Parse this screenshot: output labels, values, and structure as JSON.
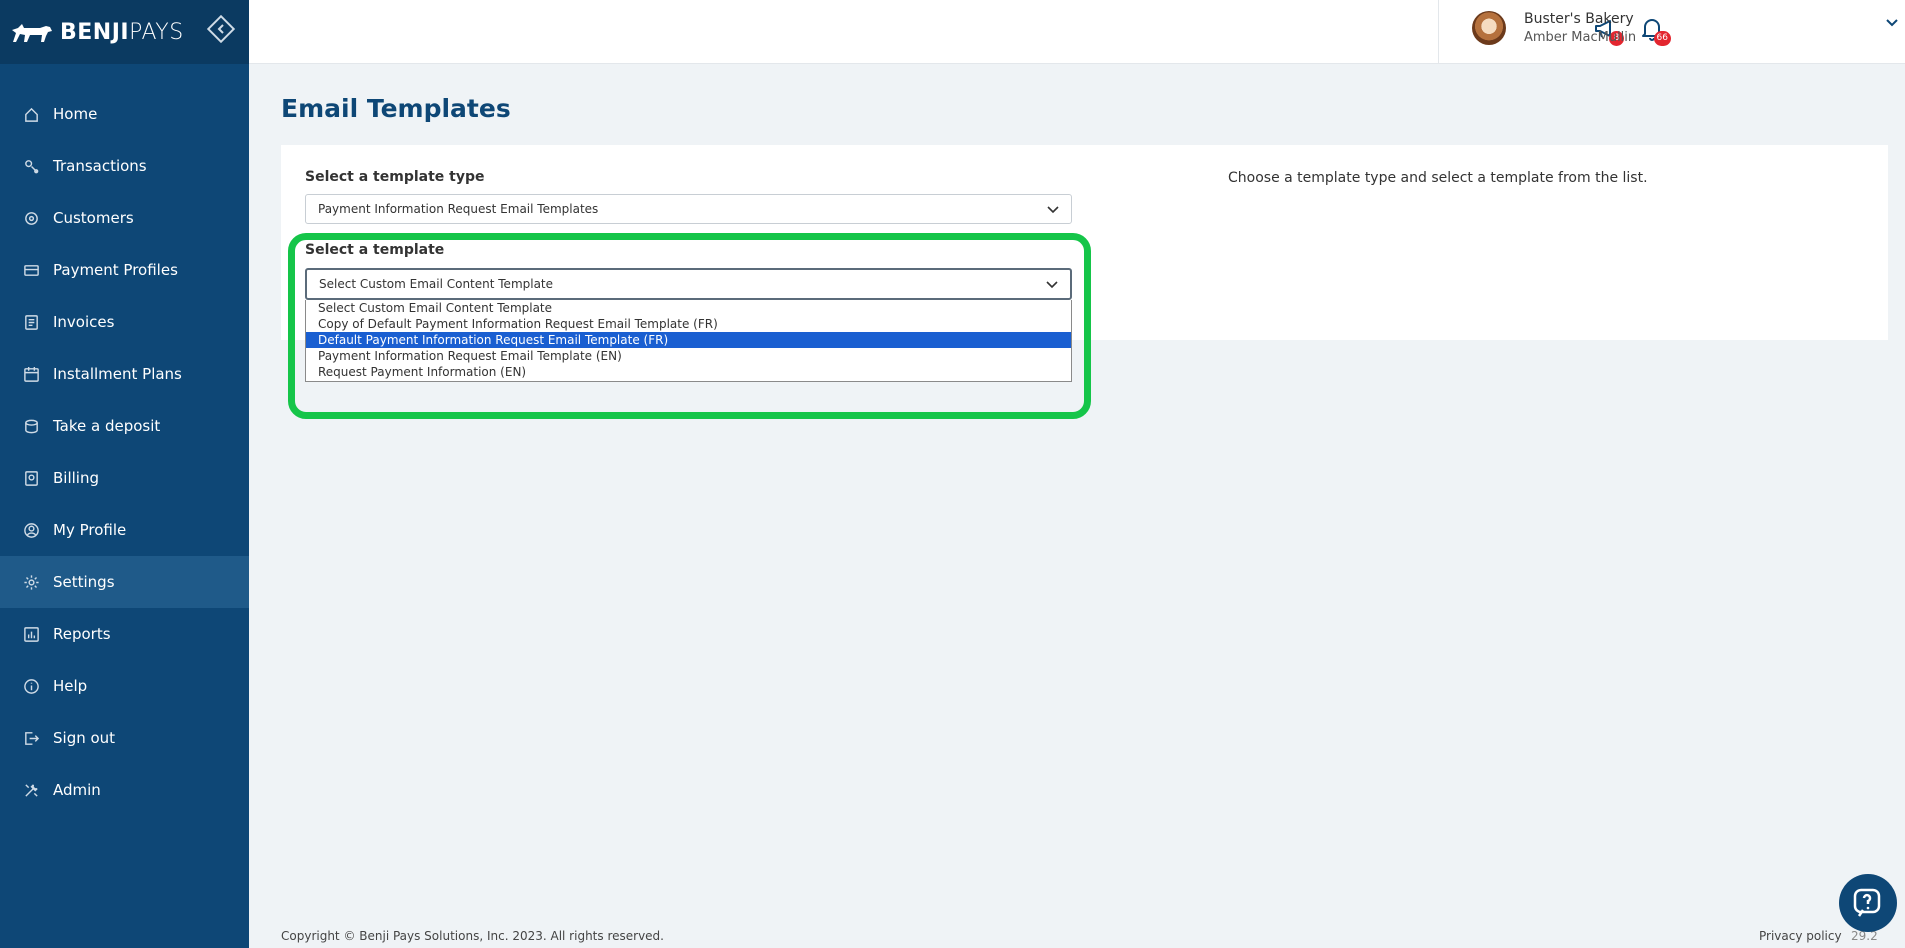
{
  "brand": {
    "name_bold": "BENJI",
    "name_light": "PAYS"
  },
  "colors": {
    "sidebar": "#0e4776",
    "accent": "#0e4776",
    "highlight": "#15c549",
    "selected_option": "#1a5fd1",
    "badge": "#e3262f"
  },
  "sidebar": {
    "items": [
      {
        "label": "Home",
        "icon": "home-icon"
      },
      {
        "label": "Transactions",
        "icon": "transactions-icon"
      },
      {
        "label": "Customers",
        "icon": "customers-icon"
      },
      {
        "label": "Payment Profiles",
        "icon": "payment-profiles-icon"
      },
      {
        "label": "Invoices",
        "icon": "invoices-icon"
      },
      {
        "label": "Installment Plans",
        "icon": "calendar-icon"
      },
      {
        "label": "Take a deposit",
        "icon": "deposit-icon"
      },
      {
        "label": "Billing",
        "icon": "billing-icon"
      },
      {
        "label": "My Profile",
        "icon": "user-icon"
      },
      {
        "label": "Settings",
        "icon": "gear-icon"
      },
      {
        "label": "Reports",
        "icon": "reports-icon"
      },
      {
        "label": "Help",
        "icon": "info-icon"
      },
      {
        "label": "Sign out",
        "icon": "sign-out-icon"
      },
      {
        "label": "Admin",
        "icon": "tools-icon"
      }
    ],
    "active": "Settings"
  },
  "header": {
    "announcements_count": "8",
    "notifications_count": "66",
    "account_name": "Buster's Bakery",
    "user_name": "Amber MacMullin"
  },
  "main": {
    "title": "Email Templates",
    "template_type_label": "Select a template type",
    "template_type_value": "Payment Information Request Email Templates",
    "template_label": "Select a template",
    "template_value": "Select Custom Email Content Template",
    "hint": "Choose a template type and select a template from the list.",
    "options": [
      "Select Custom Email Content Template",
      "Copy of Default Payment Information Request Email Template (FR)",
      "Default Payment Information Request Email Template (FR)",
      "Payment Information Request Email Template (EN)",
      "Request Payment Information (EN)"
    ],
    "highlighted_option": "Default Payment Information Request Email Template (FR)"
  },
  "footer": {
    "copyright": "Copyright © Benji Pays Solutions, Inc. 2023. All rights reserved.",
    "privacy": "Privacy policy",
    "version": "29.2"
  }
}
